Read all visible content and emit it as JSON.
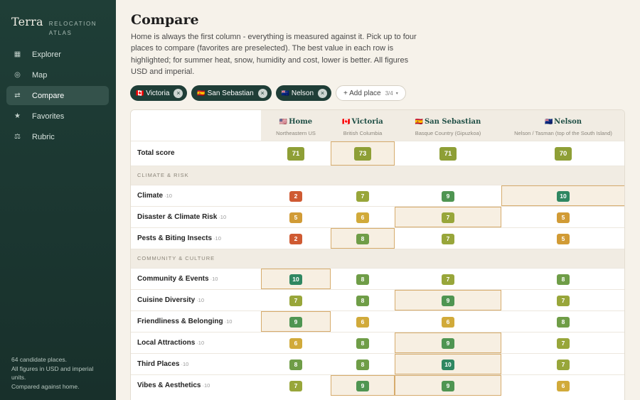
{
  "sidebar": {
    "brand_name": "Terra",
    "brand_tag": "RELOCATION ATLAS",
    "items": [
      {
        "icon": "grid-icon",
        "glyph": "▦",
        "label": "Explorer",
        "active": false
      },
      {
        "icon": "map-icon",
        "glyph": "◎",
        "label": "Map",
        "active": false
      },
      {
        "icon": "compare-icon",
        "glyph": "⇄",
        "label": "Compare",
        "active": true
      },
      {
        "icon": "star-icon",
        "glyph": "★",
        "label": "Favorites",
        "active": false
      },
      {
        "icon": "scale-icon",
        "glyph": "⚖",
        "label": "Rubric",
        "active": false
      }
    ],
    "footer": [
      "64 candidate places.",
      "All figures in USD and imperial units.",
      "Compared against home."
    ]
  },
  "header": {
    "title": "Compare",
    "description": "Home is always the first column - everything is measured against it. Pick up to four places to compare (favorites are preselected). The best value in each row is highlighted; for summer heat, snow, humidity and cost, lower is better. All figures USD and imperial."
  },
  "chips": [
    {
      "flag": "🇨🇦",
      "label": "Victoria"
    },
    {
      "flag": "🇪🇸",
      "label": "San Sebastian"
    },
    {
      "flag": "🇳🇿",
      "label": "Nelson"
    }
  ],
  "add_place": {
    "label": "+ Add place",
    "count": "3/4",
    "caret": "▾"
  },
  "columns": [
    {
      "flag": "🇺🇸",
      "name": "Home",
      "sub": "Northeastern US"
    },
    {
      "flag": "🇨🇦",
      "name": "Victoria",
      "sub": "British Columbia"
    },
    {
      "flag": "🇪🇸",
      "name": "San Sebastian",
      "sub": "Basque Country (Gipuzkoa)"
    },
    {
      "flag": "🇳🇿",
      "name": "Nelson",
      "sub": "Nelson / Tasman (top of the South Island)"
    }
  ],
  "colors": {
    "accent": "#1f3e37",
    "highlight_border": "#d6ab6c",
    "highlight_fill": "#f7efe2"
  },
  "rows": [
    {
      "type": "total",
      "label": "Total score",
      "values": [
        71,
        73,
        71,
        70
      ],
      "best": [
        1
      ]
    },
    {
      "type": "section",
      "label": "CLIMATE & RISK"
    },
    {
      "type": "metric",
      "label": "Climate",
      "of": "·10",
      "values": [
        2,
        7,
        9,
        10
      ],
      "best": [
        3
      ]
    },
    {
      "type": "metric",
      "label": "Disaster & Climate Risk",
      "of": "·10",
      "values": [
        5,
        6,
        7,
        5
      ],
      "best": [
        2
      ]
    },
    {
      "type": "metric",
      "label": "Pests & Biting Insects",
      "of": "·10",
      "values": [
        2,
        8,
        7,
        5
      ],
      "best": [
        1
      ]
    },
    {
      "type": "section",
      "label": "COMMUNITY & CULTURE"
    },
    {
      "type": "metric",
      "label": "Community & Events",
      "of": "·10",
      "values": [
        10,
        8,
        7,
        8
      ],
      "best": [
        0
      ]
    },
    {
      "type": "metric",
      "label": "Cuisine Diversity",
      "of": "·10",
      "values": [
        7,
        8,
        9,
        7
      ],
      "best": [
        2
      ]
    },
    {
      "type": "metric",
      "label": "Friendliness & Belonging",
      "of": "·10",
      "values": [
        9,
        6,
        6,
        8
      ],
      "best": [
        0
      ]
    },
    {
      "type": "metric",
      "label": "Local Attractions",
      "of": "·10",
      "values": [
        6,
        8,
        9,
        7
      ],
      "best": [
        2
      ]
    },
    {
      "type": "metric",
      "label": "Third Places",
      "of": "·10",
      "values": [
        8,
        8,
        10,
        7
      ],
      "best": [
        2
      ]
    },
    {
      "type": "metric",
      "label": "Vibes & Aesthetics",
      "of": "·10",
      "values": [
        7,
        9,
        9,
        6
      ],
      "best": [
        1,
        2
      ]
    }
  ]
}
